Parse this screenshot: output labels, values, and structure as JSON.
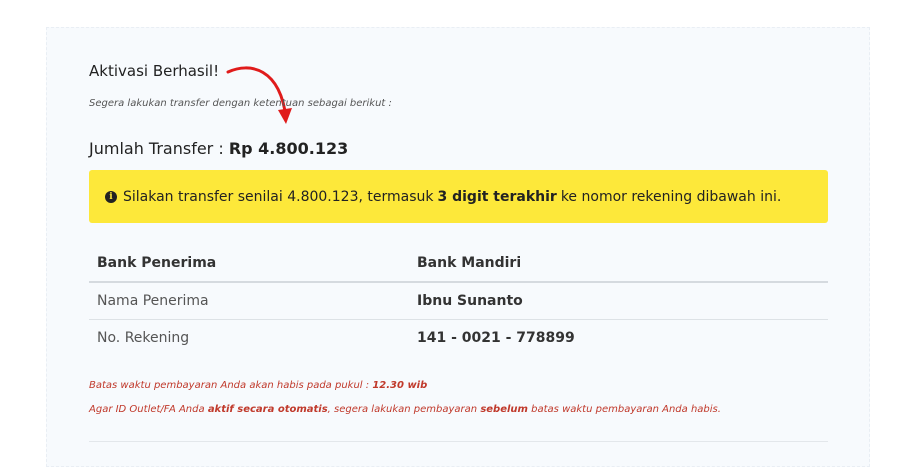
{
  "heading": "Aktivasi Berhasil!",
  "subtitle": "Segera lakukan transfer dengan ketentuan sebagai berikut :",
  "amount": {
    "label": "Jumlah Transfer :",
    "value": "Rp 4.800.123"
  },
  "alert": {
    "icon": "info-circle-icon",
    "text_before": "Silakan transfer senilai 4.800.123, termasuk",
    "bold": "3 digit terakhir",
    "text_after": "ke nomor rekening dibawah ini."
  },
  "bank_table": {
    "rows": [
      {
        "label": "Bank Penerima",
        "value": "Bank Mandiri"
      },
      {
        "label": "Nama Penerima",
        "value": "Ibnu Sunanto"
      },
      {
        "label": "No. Rekening",
        "value": "141 - 0021 - 778899"
      }
    ]
  },
  "notes": {
    "line1_text": "Batas waktu pembayaran Anda akan habis pada pukul :",
    "line1_time": "12.30 wib",
    "line2_a": "Agar ID Outlet/FA Anda",
    "line2_bold1": "aktif secara otomatis",
    "line2_b": ", segera lakukan pembayaran",
    "line2_bold2": "sebelum",
    "line2_c": "batas waktu pembayaran Anda habis."
  },
  "colors": {
    "alert_bg": "#fde83a",
    "note_red": "#c0392b",
    "arrow_red": "#e01b1b"
  }
}
